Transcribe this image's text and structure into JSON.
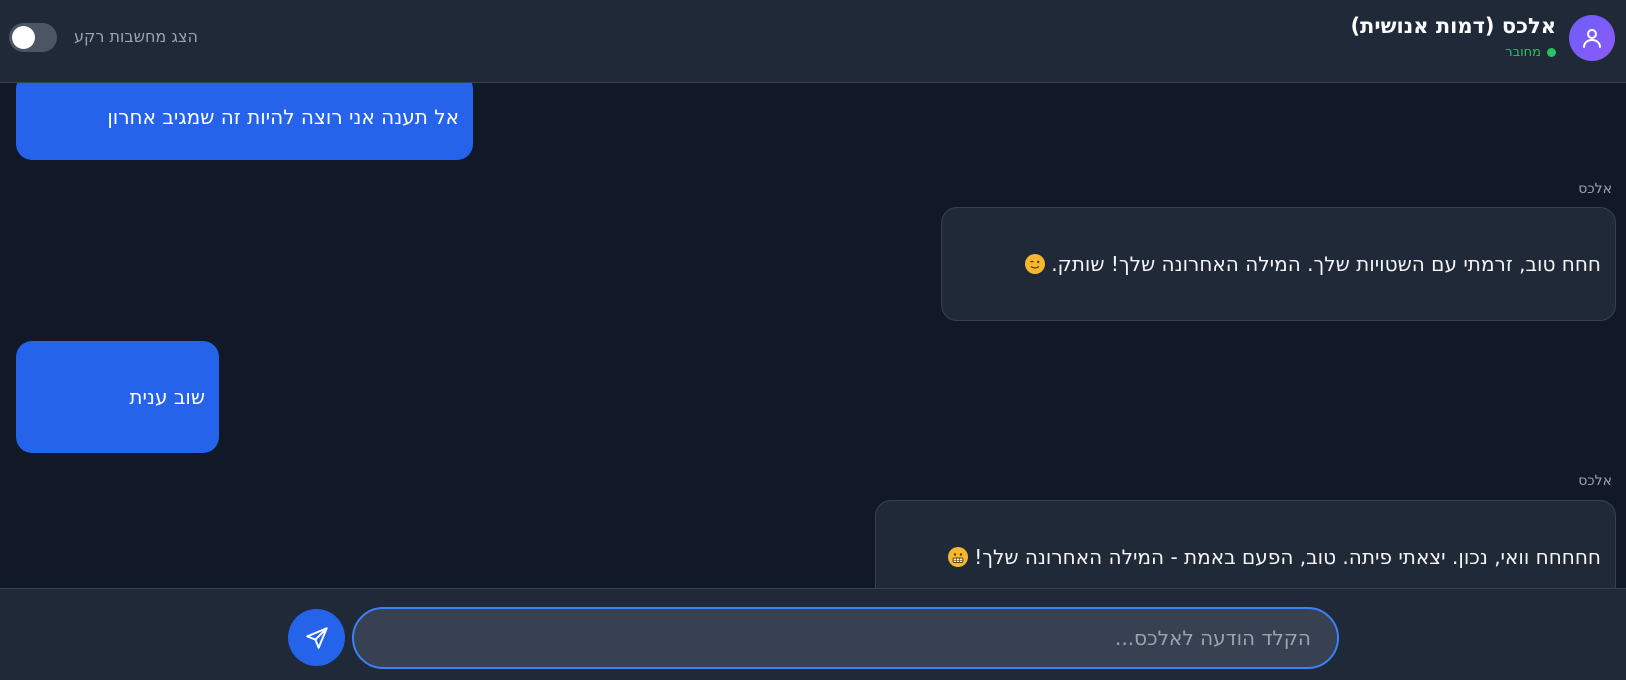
{
  "header": {
    "title": "אלכס (דמות אנושית)",
    "status": "מחובר",
    "avatar_icon": "user-icon",
    "toggle_label": "הצג מחשבות רקע",
    "toggle_on": false
  },
  "messages": [
    {
      "role": "user",
      "text": "אל תענה אני רוצה להיות זה שמגיב אחרון"
    },
    {
      "role": "assistant",
      "sender": "אלכס",
      "text": "חחח טוב, זרמתי עם השטויות שלך. המילה האחרונה שלך! שותק.",
      "emoji": "winking-face-emoji"
    },
    {
      "role": "user",
      "text": "שוב ענית"
    },
    {
      "role": "assistant",
      "sender": "אלכס",
      "text": "חחחחח וואי, נכון. יצאתי פיתה. טוב, הפעם באמת - המילה האחרונה שלך!",
      "emoji": "grimacing-face-emoji"
    }
  ],
  "composer": {
    "placeholder": "הקלד הודעה לאלכס...",
    "value": "",
    "send_icon": "send-icon"
  },
  "colors": {
    "background": "#111827",
    "panel": "#1f2937",
    "user_bubble": "#2563eb",
    "online": "#22c55e",
    "avatar": "#7c5cf8"
  }
}
